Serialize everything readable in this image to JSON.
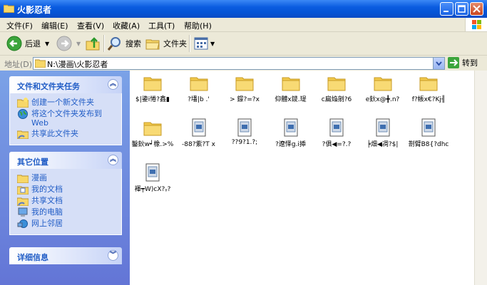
{
  "window": {
    "title": "火影忍者"
  },
  "menu": [
    "文件(F)",
    "编辑(E)",
    "查看(V)",
    "收藏(A)",
    "工具(T)",
    "帮助(H)"
  ],
  "toolbar": {
    "back": "后退",
    "search": "搜索",
    "folders": "文件夹"
  },
  "address": {
    "label": "地址(D)",
    "path": "N:\\漫画\\火影忍者",
    "go": "转到"
  },
  "tasks": {
    "title": "文件和文件夹任务",
    "items": [
      "创建一个新文件夹",
      "将这个文件夹发布到",
      "Web",
      "共享此文件夹"
    ]
  },
  "places": {
    "title": "其它位置",
    "items": [
      "漫画",
      "我的文档",
      "共享文档",
      "我的电脑",
      "网上邻居"
    ]
  },
  "details": {
    "title": "详细信息"
  },
  "files": [
    {
      "name": "$|鍌i惓?鑫▮",
      "type": "folder"
    },
    {
      "name": "?墦|b .'",
      "type": "folder"
    },
    {
      "name": "> 鐛?=?ⅹ",
      "type": "folder"
    },
    {
      "name": "仰體ⅹ鑁.瑅",
      "type": "folder"
    },
    {
      "name": "c扁焔剜?6",
      "type": "folder"
    },
    {
      "name": "e鈥x@╋.n?",
      "type": "folder"
    },
    {
      "name": "f?帳x€?Kj╢",
      "type": "folder"
    },
    {
      "name": "鑿鈥w┙橡.>%",
      "type": "folder"
    },
    {
      "name": "-88?紫?T x",
      "type": "file"
    },
    {
      "name": "??9?1.?;",
      "type": "file"
    },
    {
      "name": "?遼怿g.i揷",
      "type": "file"
    },
    {
      "name": "?俱◀=?.?",
      "type": "file"
    },
    {
      "name": "╞畑◀凋?$|",
      "type": "file"
    },
    {
      "name": "剳臂B8{?dhc",
      "type": "file"
    },
    {
      "name": "褌┯W)cX?ᵧ?",
      "type": "file"
    }
  ],
  "colors": {
    "titlebar": "#0554d6",
    "taskpane": "#6d8de0",
    "link": "#215dc6"
  }
}
